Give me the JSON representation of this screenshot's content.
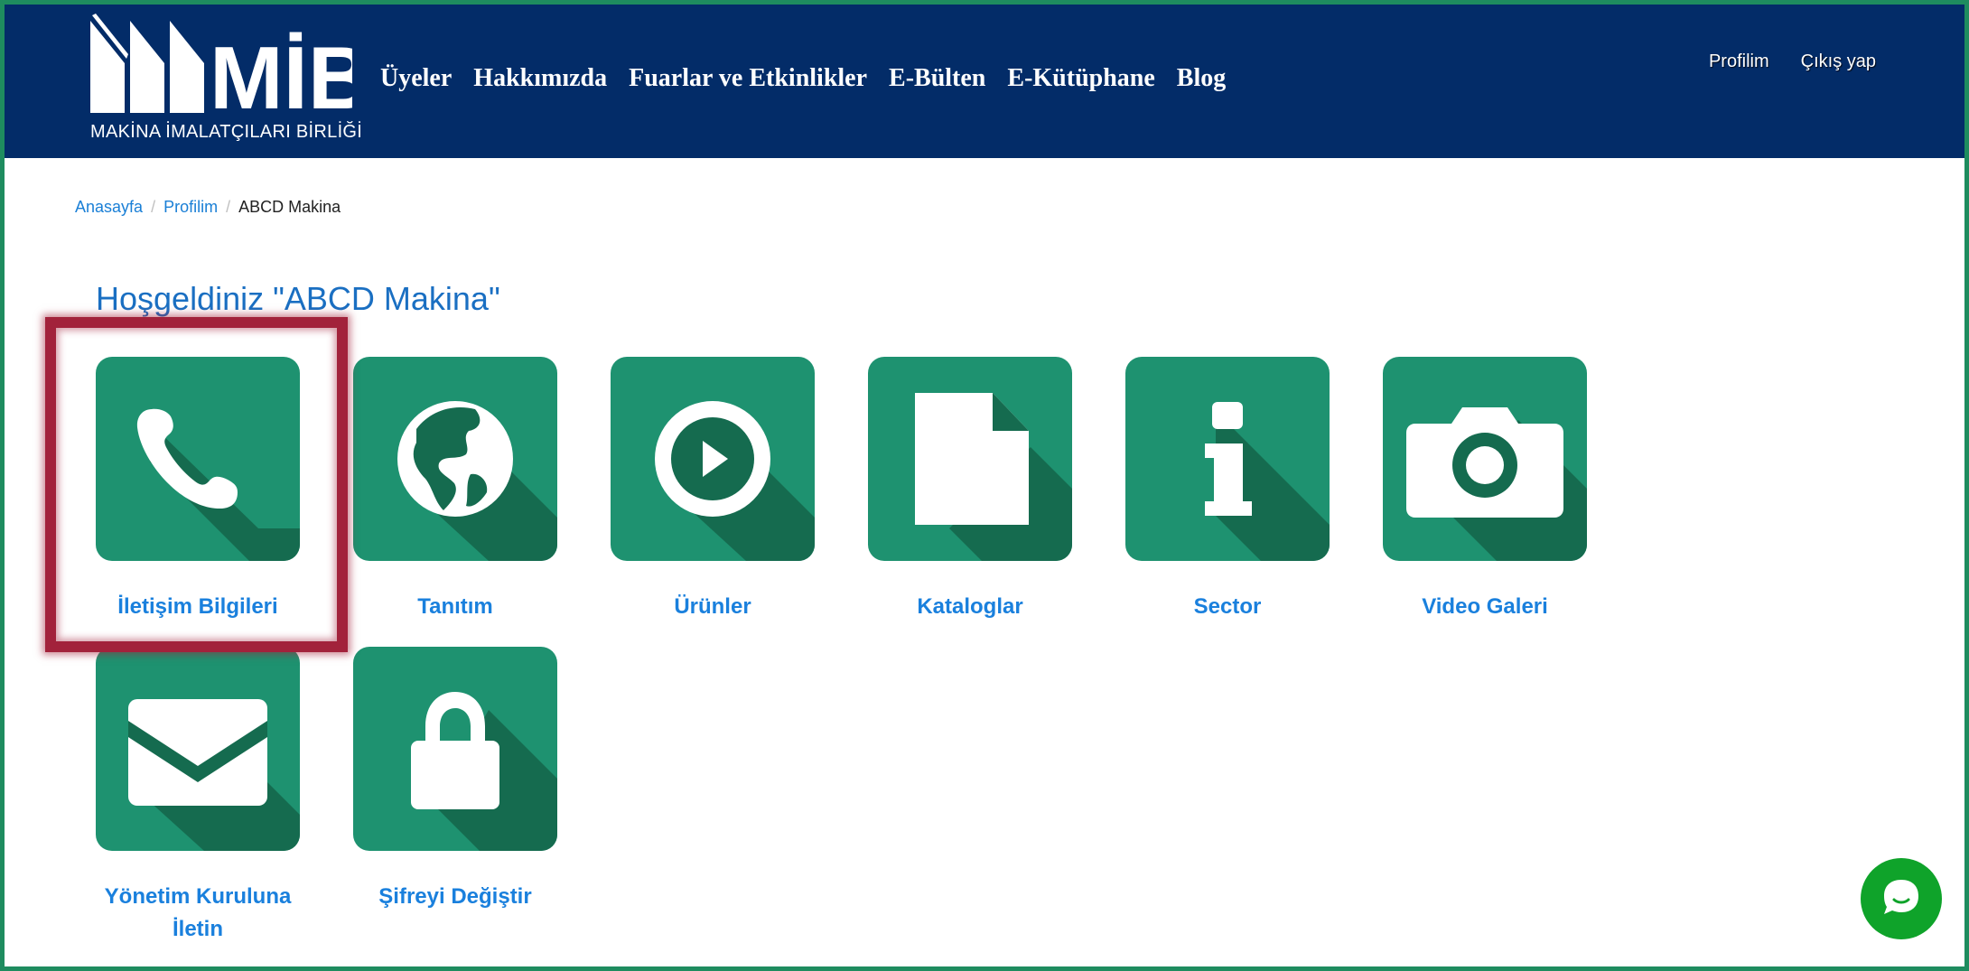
{
  "brand": {
    "logo_text": "MAKİNA İMALATÇILARI BİRLİĞİ",
    "name": "MİB"
  },
  "nav": [
    "Üyeler",
    "Hakkımızda",
    "Fuarlar ve Etkinlikler",
    "E-Bülten",
    "E-Kütüphane",
    "Blog"
  ],
  "user_links": {
    "profile": "Profilim",
    "logout": "Çıkış yap"
  },
  "breadcrumb": {
    "home": "Anasayfa",
    "profile": "Profilim",
    "current": "ABCD Makina",
    "separator": "/"
  },
  "welcome": "Hoşgeldiniz \"ABCD Makina\"",
  "tiles": [
    {
      "label": "İletişim Bilgileri",
      "icon": "phone-icon"
    },
    {
      "label": "Tanıtım",
      "icon": "globe-icon"
    },
    {
      "label": "Ürünler",
      "icon": "play-circle-icon"
    },
    {
      "label": "Kataloglar",
      "icon": "document-icon"
    },
    {
      "label": "Sector",
      "icon": "info-icon"
    },
    {
      "label": "Video Galeri",
      "icon": "camera-icon"
    },
    {
      "label": "Yönetim Kuruluna İletin",
      "icon": "envelope-icon"
    },
    {
      "label": "Şifreyi Değiştir",
      "icon": "lock-icon"
    }
  ],
  "colors": {
    "header": "#032c68",
    "tile": "#1e9270",
    "tile_shadow": "#156b4f",
    "link": "#1a80dd",
    "highlight": "#a2223b",
    "chat": "#0fa32a"
  }
}
